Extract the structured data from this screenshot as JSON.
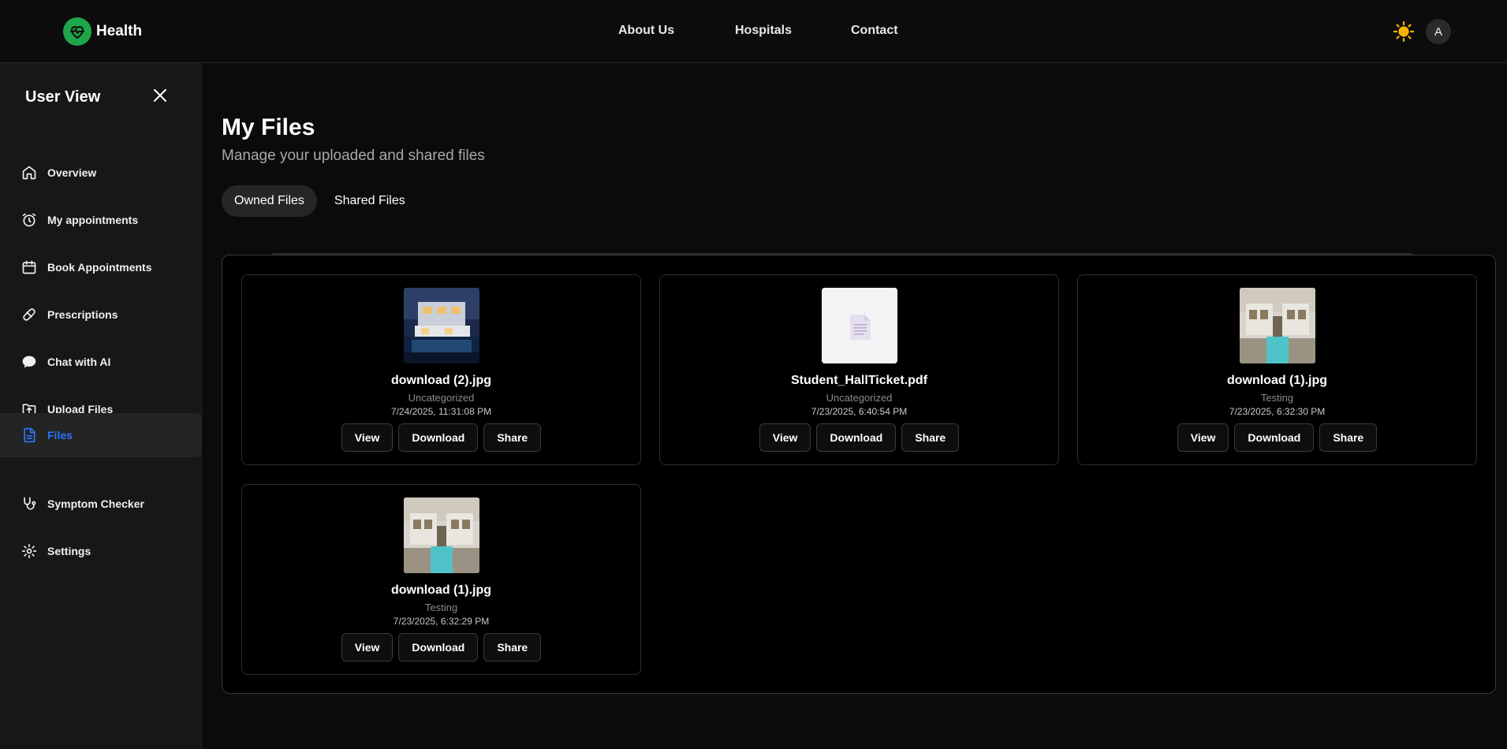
{
  "brand": {
    "name": "Health"
  },
  "nav": {
    "about": "About Us",
    "hospitals": "Hospitals",
    "contact": "Contact"
  },
  "user": {
    "avatar_initial": "A"
  },
  "sidebar": {
    "title": "User View",
    "items": [
      {
        "label": "Overview",
        "icon": "home-icon"
      },
      {
        "label": "My appointments",
        "icon": "alarm-clock-icon"
      },
      {
        "label": "Book Appointments",
        "icon": "calendar-icon"
      },
      {
        "label": "Prescriptions",
        "icon": "pill-icon"
      },
      {
        "label": "Chat with AI",
        "icon": "chat-bubble-icon"
      },
      {
        "label": "Upload Files",
        "icon": "folder-upload-icon"
      },
      {
        "label": "Files",
        "icon": "file-icon",
        "active": true
      },
      {
        "label": "Symptom Checker",
        "icon": "stethoscope-icon"
      },
      {
        "label": "Settings",
        "icon": "gear-icon"
      }
    ]
  },
  "page": {
    "title": "My Files",
    "subtitle": "Manage your uploaded and shared files",
    "tabs": [
      {
        "label": "Owned Files",
        "active": true
      },
      {
        "label": "Shared Files",
        "active": false
      }
    ]
  },
  "files": [
    {
      "name": "download (2).jpg",
      "category": "Uncategorized",
      "date": "7/24/2025, 11:31:08 PM",
      "kind": "image-night-villa"
    },
    {
      "name": "Student_HallTicket.pdf",
      "category": "Uncategorized",
      "date": "7/23/2025, 6:40:54 PM",
      "kind": "document"
    },
    {
      "name": "download (1).jpg",
      "category": "Testing",
      "date": "7/23/2025, 6:32:30 PM",
      "kind": "image-villa-pool"
    },
    {
      "name": "download (1).jpg",
      "category": "Testing",
      "date": "7/23/2025, 6:32:29 PM",
      "kind": "image-villa-pool"
    }
  ],
  "actions": {
    "view": "View",
    "download": "Download",
    "share": "Share"
  },
  "colors": {
    "accent": "#2e74ff",
    "brand_green": "#1fa64a",
    "sun": "#f5b400"
  }
}
